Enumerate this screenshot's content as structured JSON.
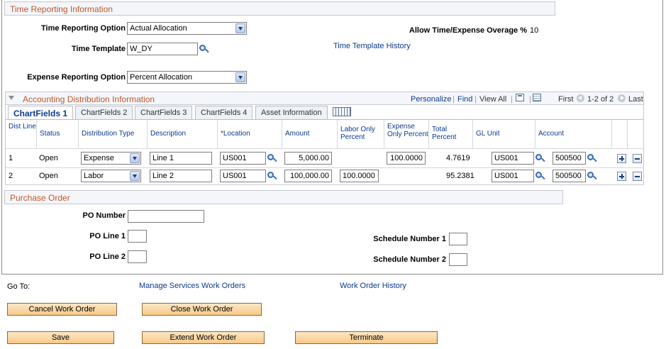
{
  "time_section": {
    "header": "Time Reporting Information",
    "time_reporting_option_label": "Time Reporting Option",
    "time_reporting_option_value": "Actual Allocation",
    "time_template_label": "Time Template",
    "time_template_value": "W_DY",
    "expense_reporting_option_label": "Expense Reporting Option",
    "expense_reporting_option_value": "Percent Allocation",
    "overage_label": "Allow Time/Expense Overage %",
    "overage_value": "10",
    "time_template_history_link": "Time Template History"
  },
  "grid": {
    "title": "Accounting Distribution Information",
    "personalize": "Personalize",
    "find": "Find",
    "view_all": "View All",
    "first": "First",
    "range": "1-2 of 2",
    "last": "Last",
    "tabs": [
      "ChartFields 1",
      "ChartFields 2",
      "ChartFields 3",
      "ChartFields 4",
      "Asset Information"
    ],
    "columns": {
      "dist_line": "Dist Line",
      "status": "Status",
      "distribution_type": "Distribution Type",
      "description": "Description",
      "location": "*Location",
      "amount": "Amount",
      "labor_only_percent": "Labor Only Percent",
      "expense_only_percent": "Expense Only Percent",
      "total_percent": "Total Percent",
      "gl_unit": "GL Unit",
      "account": "Account"
    },
    "rows": [
      {
        "dist_line": "1",
        "status": "Open",
        "distribution_type": "Expense",
        "description": "Line 1",
        "location": "US001",
        "amount": "5,000.00",
        "labor_only_percent": "",
        "expense_only_percent": "100.0000",
        "total_percent": "4.7619",
        "gl_unit": "US001",
        "account": "500500"
      },
      {
        "dist_line": "2",
        "status": "Open",
        "distribution_type": "Labor",
        "description": "Line 2",
        "location": "US001",
        "amount": "100,000.00",
        "labor_only_percent": "100.0000",
        "expense_only_percent": "",
        "total_percent": "95.2381",
        "gl_unit": "US001",
        "account": "500500"
      }
    ]
  },
  "purchase_order": {
    "header": "Purchase Order",
    "po_number_label": "PO Number",
    "po_number_value": "",
    "po_line1_label": "PO Line 1",
    "po_line1_value": "",
    "po_line2_label": "PO Line 2",
    "po_line2_value": "",
    "schedule_number1_label": "Schedule Number 1",
    "schedule_number1_value": "",
    "schedule_number2_label": "Schedule Number 2",
    "schedule_number2_value": ""
  },
  "footer": {
    "go_to": "Go To:",
    "manage_services_link": "Manage Services Work Orders",
    "work_order_history_link": "Work Order History",
    "cancel_work_order": "Cancel Work Order",
    "close_work_order": "Close Work Order",
    "save": "Save",
    "extend_work_order": "Extend Work Order",
    "terminate": "Terminate"
  }
}
